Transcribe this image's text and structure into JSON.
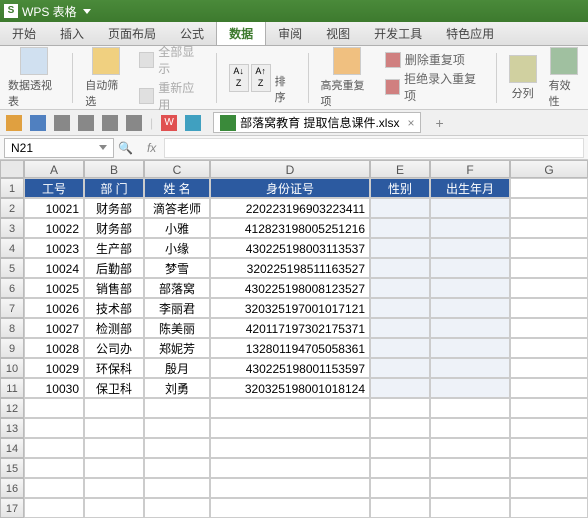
{
  "app": {
    "name": "WPS 表格"
  },
  "menu": {
    "items": [
      "开始",
      "插入",
      "页面布局",
      "公式",
      "数据",
      "审阅",
      "视图",
      "开发工具",
      "特色应用"
    ],
    "active": 4
  },
  "ribbon": {
    "pivot": "数据透视表",
    "autofilter": "自动筛选",
    "show_all": "全部显示",
    "reapply": "重新应用",
    "sort": "排序",
    "highlight_dup": "高亮重复项",
    "remove_dup": "删除重复项",
    "reject_dup": "拒绝录入重复项",
    "text_to_col": "分列",
    "validation": "有效性"
  },
  "tab": {
    "file_name": "部落窝教育 提取信息课件.xlsx"
  },
  "name_box": "N21",
  "columns": [
    "A",
    "B",
    "C",
    "D",
    "E",
    "F",
    "G"
  ],
  "headers": {
    "A": "工号",
    "B": "部 门",
    "C": "姓 名",
    "D": "身份证号",
    "E": "性别",
    "F": "出生年月"
  },
  "rows": [
    {
      "A": "10021",
      "B": "财务部",
      "C": "滴答老师",
      "D": "220223196903223411"
    },
    {
      "A": "10022",
      "B": "财务部",
      "C": "小雅",
      "D": "412823198005251216"
    },
    {
      "A": "10023",
      "B": "生产部",
      "C": "小缘",
      "D": "430225198003113537"
    },
    {
      "A": "10024",
      "B": "后勤部",
      "C": "梦雪",
      "D": "320225198511163527"
    },
    {
      "A": "10025",
      "B": "销售部",
      "C": "部落窝",
      "D": "430225198008123527"
    },
    {
      "A": "10026",
      "B": "技术部",
      "C": "李丽君",
      "D": "320325197001017121"
    },
    {
      "A": "10027",
      "B": "检测部",
      "C": "陈美丽",
      "D": "420117197302175371"
    },
    {
      "A": "10028",
      "B": "公司办",
      "C": "郑妮芳",
      "D": "132801194705058361"
    },
    {
      "A": "10029",
      "B": "环保科",
      "C": "殷月",
      "D": "430225198001153597"
    },
    {
      "A": "10030",
      "B": "保卫科",
      "C": "刘勇",
      "D": "320325198001018124"
    }
  ]
}
